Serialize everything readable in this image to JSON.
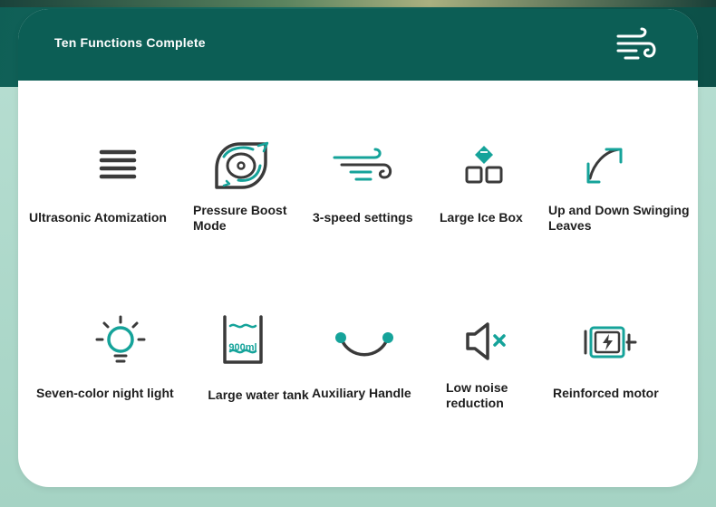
{
  "header": {
    "title": "Ten Functions Complete",
    "logo_icon": "wind-icon"
  },
  "colors": {
    "accent": "#15a39a",
    "dark": "#3a3a3a",
    "header": "#0c5e55"
  },
  "features": [
    {
      "label": "Ultrasonic Atomization",
      "icon": "menu-lines-icon"
    },
    {
      "label": "Pressure Boost Mode",
      "icon": "pressure-swirl-icon"
    },
    {
      "label": "3-speed settings",
      "icon": "wind-speed-icon"
    },
    {
      "label": "Large Ice Box",
      "icon": "ice-cubes-icon"
    },
    {
      "label": "Up and Down Swinging Leaves",
      "icon": "swing-arrows-icon"
    },
    {
      "label": "Seven-color night light",
      "icon": "light-bulb-icon"
    },
    {
      "label": "Large water tank",
      "icon": "water-tank-icon",
      "tank_text": "900ml"
    },
    {
      "label": "Auxiliary Handle",
      "icon": "handle-icon"
    },
    {
      "label": "Low noise reduction",
      "icon": "speaker-mute-icon"
    },
    {
      "label": "Reinforced motor",
      "icon": "battery-motor-icon"
    }
  ]
}
